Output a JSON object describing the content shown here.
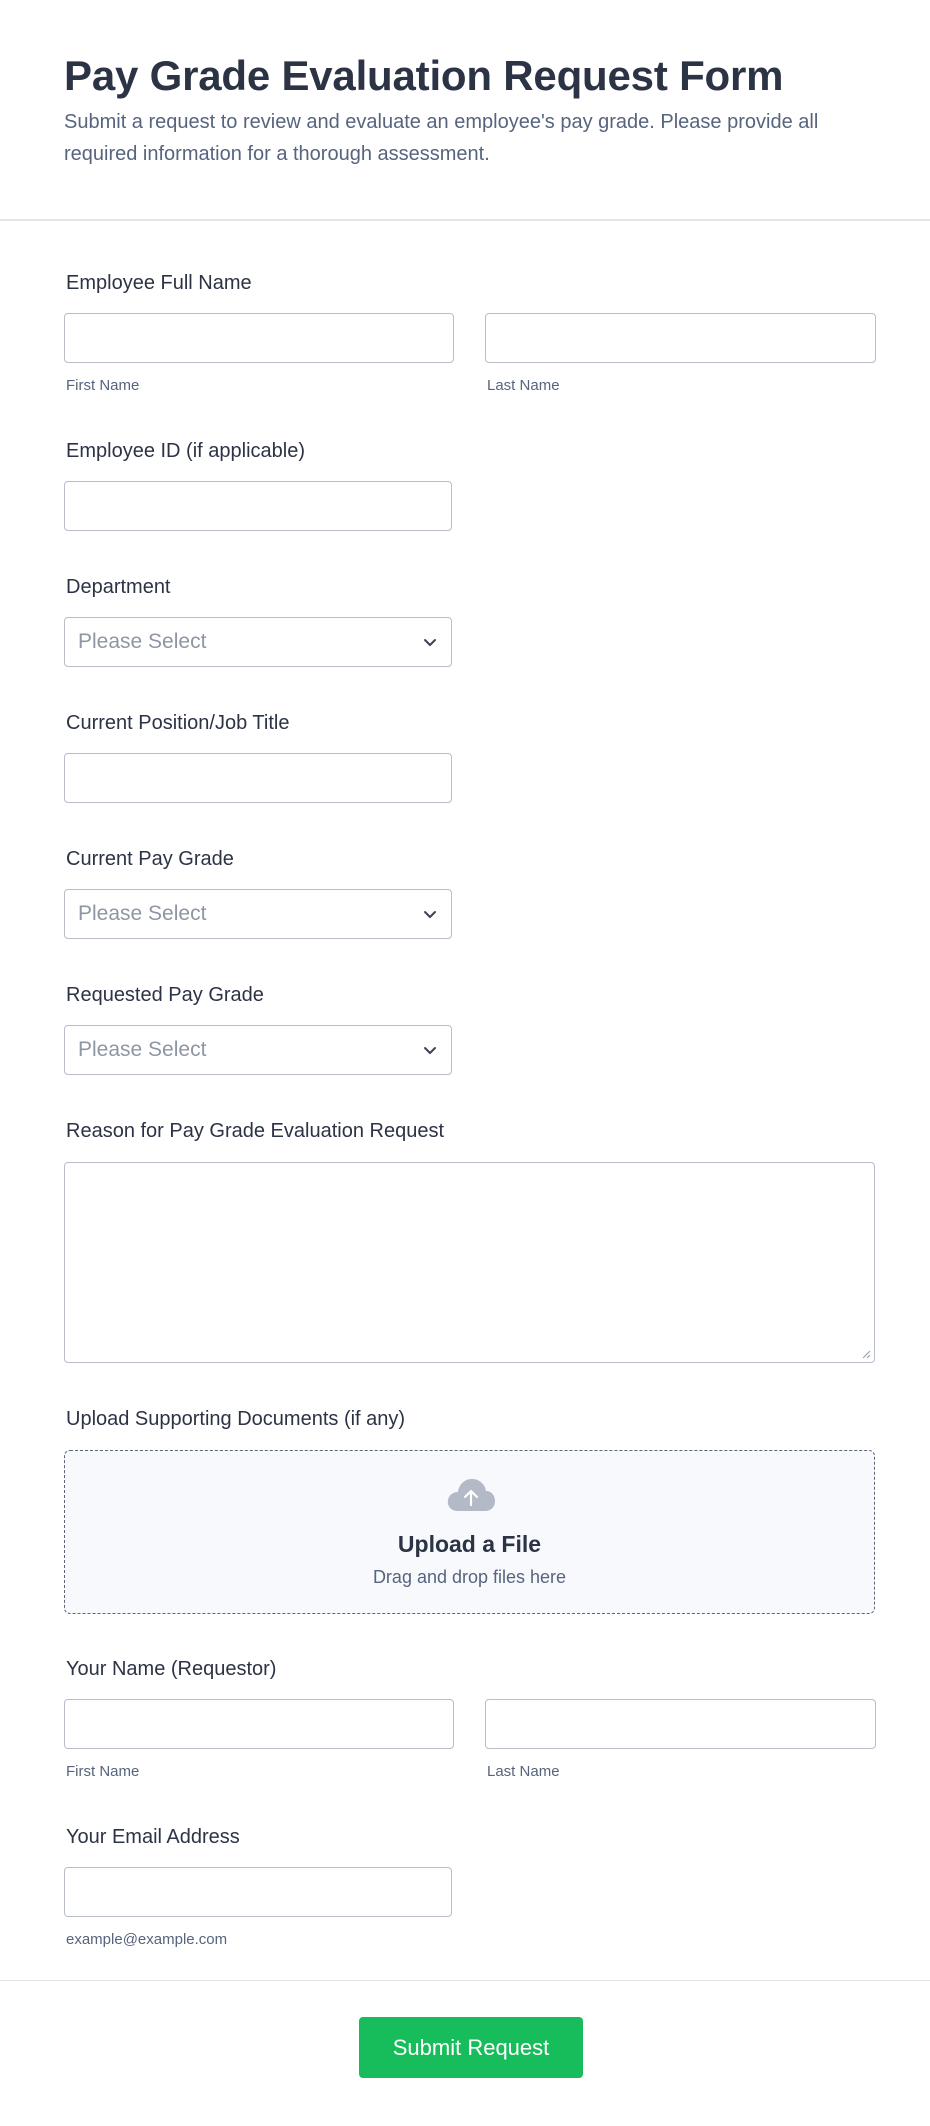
{
  "form": {
    "title": "Pay Grade Evaluation Request Form",
    "subtitle": "Submit a request to review and evaluate an employee's pay grade. Please provide all required information for a thorough assessment."
  },
  "employee_name": {
    "label": "Employee Full Name",
    "first_sublabel": "First Name",
    "last_sublabel": "Last Name",
    "first_value": "",
    "last_value": ""
  },
  "employee_id": {
    "label": "Employee ID (if applicable)",
    "value": ""
  },
  "department": {
    "label": "Department",
    "selected": "Please Select"
  },
  "position": {
    "label": "Current Position/Job Title",
    "value": ""
  },
  "current_grade": {
    "label": "Current Pay Grade",
    "selected": "Please Select"
  },
  "requested_grade": {
    "label": "Requested Pay Grade",
    "selected": "Please Select"
  },
  "reason": {
    "label": "Reason for Pay Grade Evaluation Request",
    "value": ""
  },
  "upload": {
    "label": "Upload Supporting Documents (if any)",
    "title": "Upload a File",
    "subtitle": "Drag and drop files here",
    "icon": "cloud-upload-icon"
  },
  "requestor_name": {
    "label": "Your Name (Requestor)",
    "first_sublabel": "First Name",
    "last_sublabel": "Last Name",
    "first_value": "",
    "last_value": ""
  },
  "email": {
    "label": "Your Email Address",
    "sublabel": "example@example.com",
    "value": ""
  },
  "submit": {
    "label": "Submit Request"
  },
  "colors": {
    "submit_button": "#18bd5b",
    "heading_text": "#2c3345",
    "muted_text": "#57647e",
    "placeholder_text": "#8f96a3",
    "input_border": "#b8bdc9"
  }
}
